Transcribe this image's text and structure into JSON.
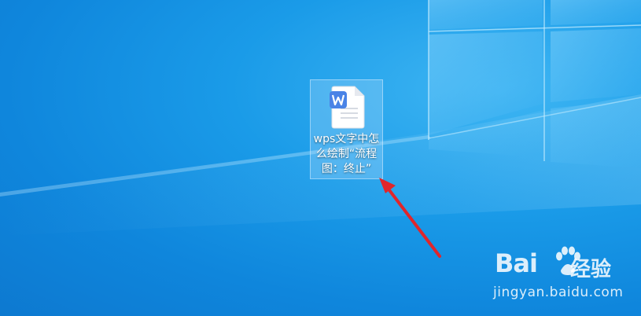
{
  "desktop": {
    "background_color": "#1190e0",
    "wallpaper": "windows-10-light-window-logo"
  },
  "desktop_icon": {
    "icon": "wps-writer-document-icon",
    "icon_color": "#4a83e6",
    "label_line1": "wps文字中怎",
    "label_line2": "么绘制“流程",
    "label_line3": "图：终止”",
    "selected": true
  },
  "annotation": {
    "type": "arrow",
    "color": "#e0262c"
  },
  "watermark": {
    "brand_left": "Bai",
    "brand_right": "经验",
    "url": "jingyan.baidu.com"
  }
}
